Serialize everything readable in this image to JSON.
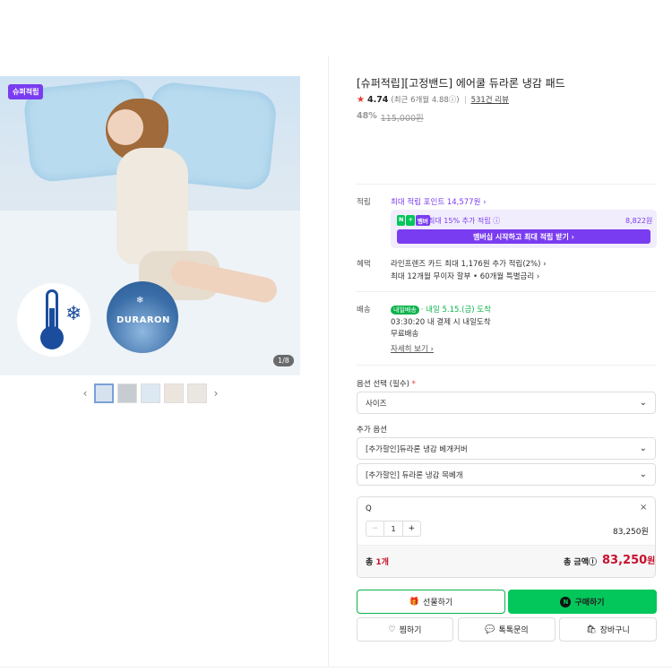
{
  "gallery": {
    "badge": "슈퍼적립",
    "product_logo": "DURARON",
    "counter": "1/8",
    "prev_arrow": "‹",
    "next_arrow": "›"
  },
  "product": {
    "title": "[슈퍼적립][고정밴드] 에어쿨 듀라론 냉감 패드",
    "rating": "4.74",
    "rating_sub": "(최근 6개월 4.88ⓘ)",
    "reviews": "531건 리뷰",
    "discount": "48%",
    "original_price": "115,000원"
  },
  "points": {
    "label": "적립",
    "max_points": "최대 적립 포인트 14,577원 ›",
    "nplus_badges": [
      "N",
      "+",
      "멤버"
    ],
    "extra_text": "최대 15% 추가 적립 ⓘ",
    "extra_amount": "8,822원",
    "membership_button": "멤버십 시작하고 최대 적립 받기 ›"
  },
  "benefits": {
    "label": "혜택",
    "line1": "라인프렌즈 카드 최대 1,176원 추가 적립(2%) ›",
    "line2": "최대 12개월 무이자 할부 • 60개월 특별금리 ›"
  },
  "shipping": {
    "label": "배송",
    "badge": "내일배송",
    "arrival": "· 내일 5.15.(금) 도착",
    "cutoff": "03:30:20  내 결제 시 내일도착",
    "free": "무료배송",
    "details_link": "자세히 보기 ›"
  },
  "options": {
    "required_title": "옵션 선택 (필수)",
    "required_mark": "*",
    "size_select": "사이즈",
    "additional_title": "추가 옵션",
    "add1": "[추가할인]듀라론 냉감 베개커버",
    "add2": "[추가할인] 듀라론 냉감 목베개",
    "chevron": "⌄"
  },
  "selected": {
    "name": "Q",
    "close": "×",
    "minus": "−",
    "qty": "1",
    "plus": "+",
    "price": "83,250원",
    "total_label_prefix": "총 ",
    "total_count": "1개",
    "total_amount_label": "총 금액ⓘ",
    "total_amount": "83,250",
    "won": "원"
  },
  "actions": {
    "gift": "선물하기",
    "buy": "구매하기",
    "wish": "찜하기",
    "talk": "톡톡문의",
    "cart": "장바구니"
  },
  "colors": {
    "accent_purple": "#7a3cf0",
    "naver_green": "#03c75a",
    "price_red": "#c8102e"
  }
}
